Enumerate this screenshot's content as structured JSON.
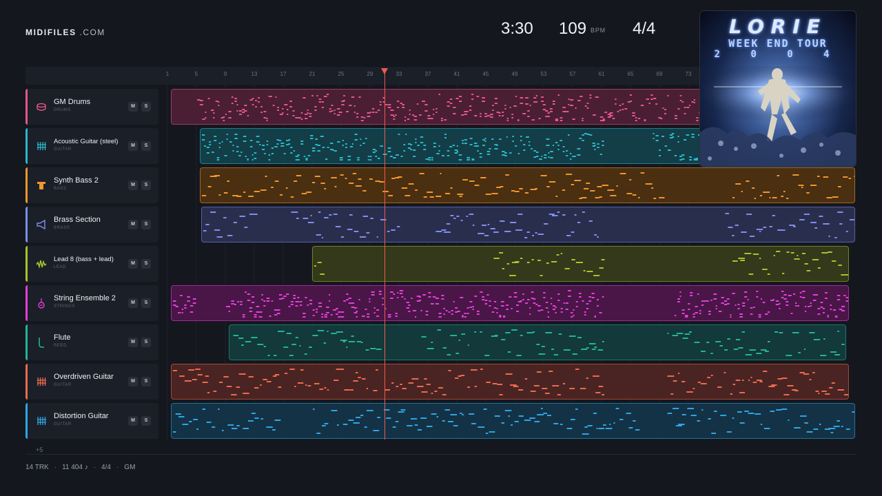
{
  "brand": {
    "name": "MIDIFILES",
    "domain": ".COM"
  },
  "stats": {
    "time": "3:30",
    "tempo": "109",
    "tempo_unit": "BPM",
    "signature": "4/4"
  },
  "ruler": {
    "ticks": [
      "1",
      "5",
      "9",
      "13",
      "17",
      "21",
      "25",
      "29",
      "33",
      "37",
      "41",
      "45",
      "49",
      "53",
      "57",
      "61",
      "65",
      "69",
      "73"
    ]
  },
  "playhead_bar": 30.5,
  "tracks": [
    {
      "name": "GM Drums",
      "category": "DRUMS",
      "icon": "drum-icon",
      "color": "#e6568b",
      "fill": "#4a1f33",
      "mute": "M",
      "solo": "S"
    },
    {
      "name": "Acoustic Guitar (steel)",
      "category": "GUITAR",
      "icon": "guitar-grid-icon",
      "color": "#2bb7c9",
      "fill": "#133e47",
      "mute": "M",
      "solo": "S"
    },
    {
      "name": "Synth Bass 2",
      "category": "BASS",
      "icon": "bass-icon",
      "color": "#f2962e",
      "fill": "#4a2f11",
      "mute": "M",
      "solo": "S"
    },
    {
      "name": "Brass Section",
      "category": "BRASS",
      "icon": "brass-icon",
      "color": "#7f8ef0",
      "fill": "#2a2e4d",
      "mute": "M",
      "solo": "S"
    },
    {
      "name": "Lead 8 (bass + lead)",
      "category": "LEAD",
      "icon": "waveform-icon",
      "color": "#a9c42e",
      "fill": "#33391a",
      "mute": "M",
      "solo": "S"
    },
    {
      "name": "String Ensemble 2",
      "category": "STRINGS",
      "icon": "violin-icon",
      "color": "#e43fd9",
      "fill": "#4a1648",
      "mute": "M",
      "solo": "S"
    },
    {
      "name": "Flute",
      "category": "REED",
      "icon": "flute-icon",
      "color": "#22b596",
      "fill": "#13393a",
      "mute": "M",
      "solo": "S"
    },
    {
      "name": "Overdriven Guitar",
      "category": "GUITAR",
      "icon": "guitar-grid-icon",
      "color": "#ee6b4d",
      "fill": "#4a2423",
      "mute": "M",
      "solo": "S"
    },
    {
      "name": "Distortion Guitar",
      "category": "GUITAR",
      "icon": "guitar-grid-icon",
      "color": "#2ea6e6",
      "fill": "#143246",
      "mute": "M",
      "solo": "S"
    }
  ],
  "cover": {
    "title": "LORIE",
    "subtitle": "WEEK END TOUR",
    "year": "2 0 0 4"
  },
  "more_tracks": "+5",
  "footer": {
    "tracks": "14 TRK",
    "notes": "11 404 ♪",
    "signature": "4/4",
    "standard": "GM"
  }
}
